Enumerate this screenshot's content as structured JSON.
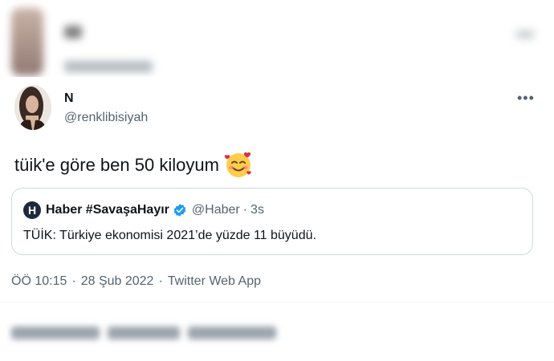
{
  "tweet": {
    "author_name": "N",
    "author_handle": "@renklibisiyah",
    "more_icon": "more-icon",
    "text": "tüik'e göre ben 50 kiloyum",
    "emoji": "smiling-face-with-hearts-emoji",
    "quote": {
      "logo_letter": "H",
      "name": "Haber #SavaşaHayır",
      "handle": "@Haber",
      "separator": "·",
      "time": "3s",
      "text": "TÜİK: Türkiye ekonomisi 2021’de yüzde 11 büyüdü."
    },
    "meta": {
      "time": "ÖÖ 10:15",
      "sep1": "·",
      "date": "28 Şub 2022",
      "sep2": "·",
      "app": "Twitter Web App"
    }
  },
  "colors": {
    "text": "#0f1419",
    "secondary": "#536471",
    "border": "#cfd9de",
    "verified": "#1d9bf0"
  }
}
